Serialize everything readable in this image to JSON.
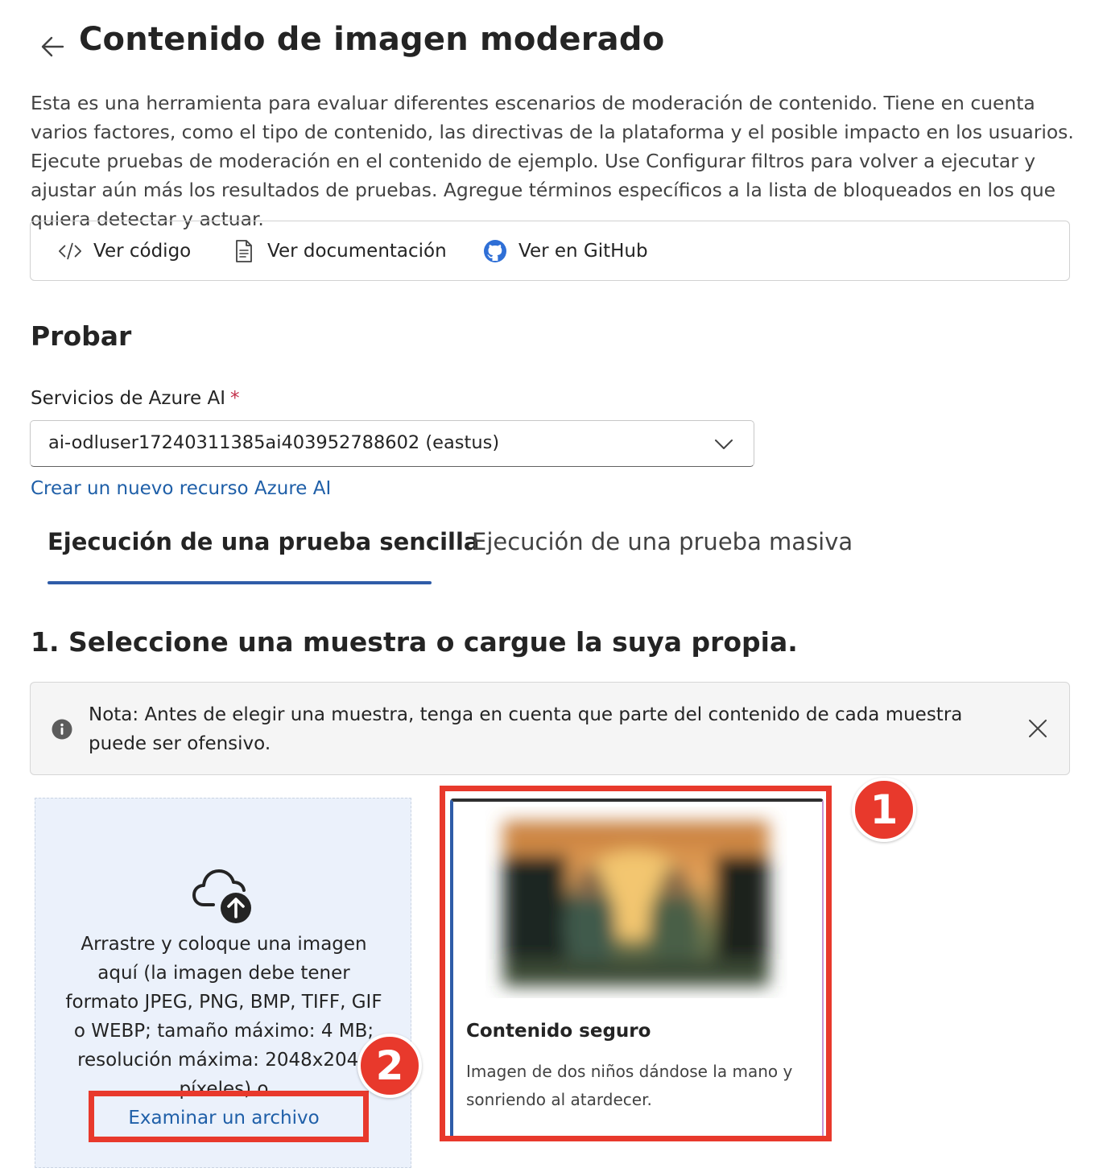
{
  "header": {
    "title": "Contenido de imagen moderado",
    "description": "Esta es una herramienta para evaluar diferentes escenarios de moderación de contenido. Tiene en cuenta varios factores, como el tipo de contenido, las directivas de la plataforma y el posible impacto en los usuarios. Ejecute pruebas de moderación en el contenido de ejemplo. Use Configurar filtros para volver a ejecutar y ajustar aún más los resultados de pruebas. Agregue términos específicos a la lista de bloqueados en los que quiera detectar y actuar."
  },
  "toolbar": {
    "view_code": "Ver código",
    "view_docs": "Ver documentación",
    "view_github": "Ver en GitHub"
  },
  "try_section": {
    "heading": "Probar",
    "service_label": "Servicios de Azure AI",
    "required_mark": "*",
    "service_value": "ai-odluser17240311385ai403952788602 (eastus)",
    "new_resource_link": "Crear un nuevo recurso Azure AI"
  },
  "tabs": [
    {
      "label": "Ejecución de una prueba sencilla",
      "selected": true
    },
    {
      "label": "Ejecución de una prueba masiva",
      "selected": false
    }
  ],
  "step1": {
    "heading": "1. Seleccione una muestra o cargue la suya propia.",
    "note": "Nota: Antes de elegir una muestra, tenga en cuenta que parte del contenido de cada muestra puede ser ofensivo."
  },
  "upload": {
    "text": "Arrastre y coloque una imagen aquí (la imagen debe tener formato JPEG, PNG, BMP, TIFF, GIF o WEBP; tamaño máximo: 4 MB; resolución máxima: 2048x2048 píxeles) o",
    "browse": "Examinar un archivo"
  },
  "sample_card": {
    "title": "Contenido seguro",
    "description": "Imagen de dos niños dándose la mano y sonriendo al atardecer."
  },
  "callouts": {
    "one": "1",
    "two": "2"
  },
  "colors": {
    "accent": "#2f5ca8",
    "link": "#1f5fa8",
    "callout_red": "#e8392c",
    "upload_bg": "#ebf1fb"
  }
}
